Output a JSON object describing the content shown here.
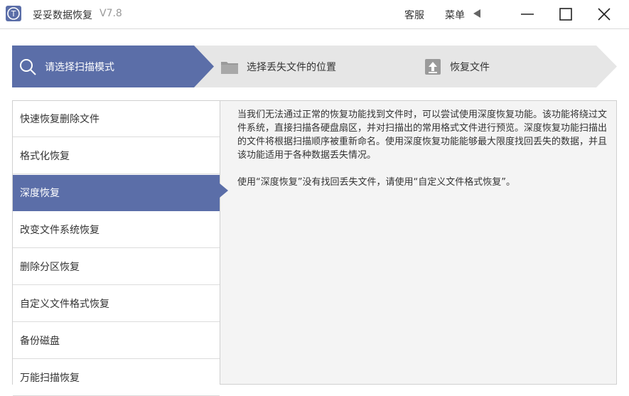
{
  "window": {
    "app_name": "妥妥数据恢复",
    "version": "V7.8",
    "service_label": "客服",
    "menu_label": "菜单",
    "logo_text": "T"
  },
  "steps": [
    {
      "label": "请选择扫描模式",
      "icon": "search-icon",
      "active": true
    },
    {
      "label": "选择丢失文件的位置",
      "icon": "folder-icon",
      "active": false
    },
    {
      "label": "恢复文件",
      "icon": "restore-icon",
      "active": false
    }
  ],
  "sidebar": {
    "items": [
      {
        "label": "快速恢复删除文件"
      },
      {
        "label": "格式化恢复"
      },
      {
        "label": "深度恢复",
        "active": true
      },
      {
        "label": "改变文件系统恢复"
      },
      {
        "label": "删除分区恢复"
      },
      {
        "label": "自定义文件格式恢复"
      },
      {
        "label": "备份磁盘"
      },
      {
        "label": "万能扫描恢复"
      }
    ]
  },
  "content": {
    "paragraph1": "当我们无法通过正常的恢复功能找到文件时，可以尝试使用深度恢复功能。该功能将绕过文件系统，直接扫描各硬盘扇区，并对扫描出的常用格式文件进行预览。深度恢复功能扫描出的文件将根据扫描顺序被重新命名。使用深度恢复功能能够最大限度找回丢失的数据，并且该功能适用于各种数据丢失情况。",
    "paragraph2": "使用“深度恢复”没有找回丢失文件，请使用“自定义文件格式恢复”。"
  },
  "colors": {
    "accent": "#5b6ea8",
    "inactive_step": "#e6e6e6"
  }
}
